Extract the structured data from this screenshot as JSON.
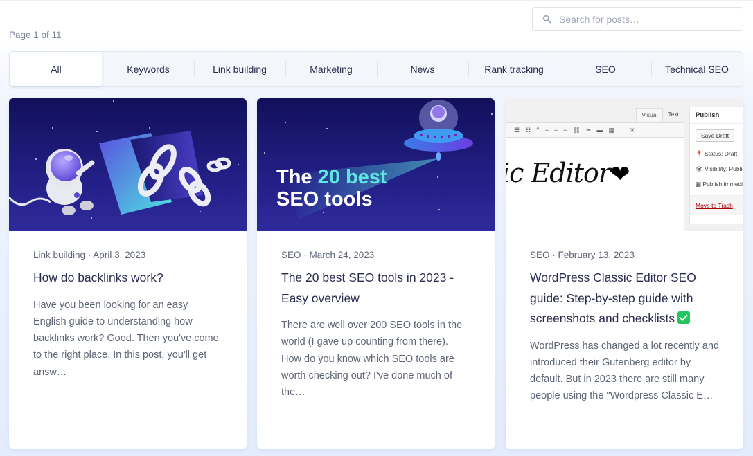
{
  "header": {
    "page_count": "Page 1 of 11",
    "search": {
      "placeholder": "Search for posts…",
      "value": "",
      "icon": "search-icon"
    }
  },
  "categories": {
    "active": "All",
    "items": [
      {
        "label": "All"
      },
      {
        "label": "Keywords"
      },
      {
        "label": "Link building"
      },
      {
        "label": "Marketing"
      },
      {
        "label": "News"
      },
      {
        "label": "Rank tracking"
      },
      {
        "label": "SEO"
      },
      {
        "label": "Technical SEO"
      }
    ]
  },
  "posts": [
    {
      "category": "Link building",
      "date": "April 3, 2023",
      "meta": "Link building · April 3, 2023",
      "title": "How do backlinks work?",
      "excerpt": "Have you been looking for an easy English guide to understanding how backlinks work? Good. Then you've come to the right place. In this post, you'll get answ…",
      "image": "astronaut-with-chain-links-illustration"
    },
    {
      "category": "SEO",
      "date": "March 24, 2023",
      "meta": "SEO · March 24, 2023",
      "title": "The 20 best SEO tools in 2023 - Easy overview",
      "excerpt": "There are well over 200 SEO tools in the world (I gave up counting from there). How do you know which SEO tools are worth checking out? I've done much of the…",
      "image": "ufo-spotlight-illustration",
      "image_text": {
        "line1_a": "The ",
        "line1_b": "20 best",
        "line2": "SEO tools"
      }
    },
    {
      "category": "SEO",
      "date": "February 13, 2023",
      "meta": "SEO · February 13, 2023",
      "title": "WordPress Classic Editor SEO guide: Step-by-step guide with screenshots and checklists",
      "title_badge": "check-mark-icon",
      "excerpt": "WordPress has changed a lot recently and introduced their Gutenberg editor by default. But in 2023 there are still many people using the \"Wordpress Classic E…",
      "image": "wordpress-classic-editor-screenshot",
      "image_text": {
        "tab_visual": "Visual",
        "tab_text": "Text",
        "script": "ic Editor",
        "heart": "❤",
        "publish_title": "Publish",
        "save_draft": "Save Draft",
        "status": "Status: Draft",
        "visibility": "Visibility: Public",
        "publish_when": "Publish immediately",
        "trash": "Move to Trash"
      }
    }
  ],
  "colors": {
    "text_dark": "#2b2d4f",
    "text_muted": "#5e6577",
    "accent_teal": "#5ee6e0",
    "space_dark": "#12105a",
    "check_green": "#22c55e"
  }
}
